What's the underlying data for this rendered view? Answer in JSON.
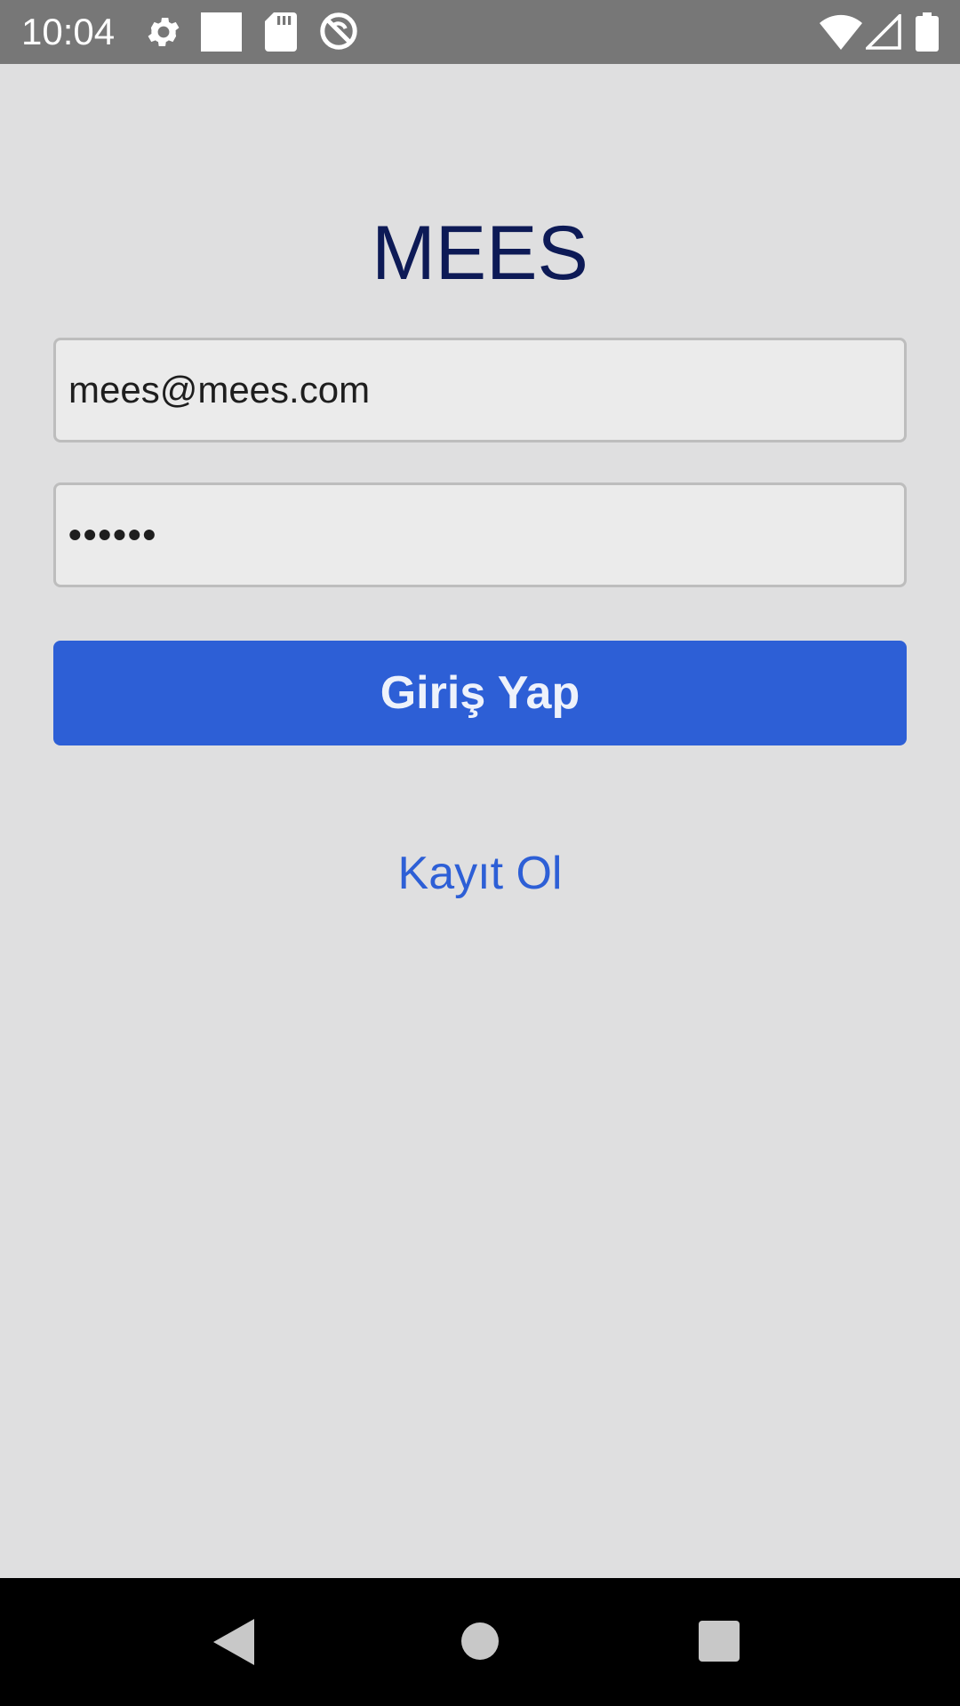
{
  "status_bar": {
    "time": "10:04",
    "left_icons": [
      "gear-icon",
      "square-icon",
      "sd-card-icon",
      "sync-disabled-icon"
    ],
    "right_icons": [
      "wifi-icon",
      "cell-signal-icon",
      "battery-icon"
    ]
  },
  "app": {
    "title": "MEES",
    "email": {
      "value": "mees@mees.com"
    },
    "password": {
      "value": "••••••"
    },
    "login_button_label": "Giriş Yap",
    "register_link_label": "Kayıt Ol"
  },
  "colors": {
    "background": "#dfdfe0",
    "title": "#0d1a56",
    "primary": "#2d5fd6",
    "field_background": "#ebebeb",
    "field_border": "#bdbdbd"
  },
  "nav_bar": {
    "icons": [
      "back-icon",
      "home-icon",
      "recents-icon"
    ]
  }
}
